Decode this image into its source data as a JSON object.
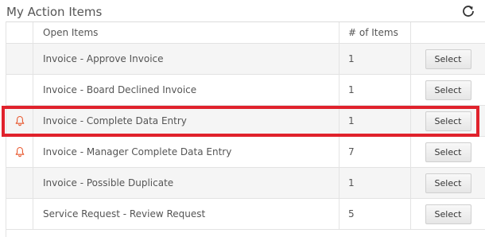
{
  "panel": {
    "title": "My Action Items",
    "refresh_icon": "refresh-icon"
  },
  "table": {
    "headers": {
      "icon": "",
      "open_items": "Open Items",
      "count": "# of Items",
      "action": ""
    },
    "rows": [
      {
        "label": "Invoice - Approve Invoice",
        "count": "1",
        "button": "Select",
        "alert": false
      },
      {
        "label": "Invoice - Board Declined Invoice",
        "count": "1",
        "button": "Select",
        "alert": false
      },
      {
        "label": "Invoice - Complete Data Entry",
        "count": "1",
        "button": "Select",
        "alert": true
      },
      {
        "label": "Invoice - Manager Complete Data Entry",
        "count": "7",
        "button": "Select",
        "alert": true
      },
      {
        "label": "Invoice - Possible Duplicate",
        "count": "1",
        "button": "Select",
        "alert": false
      },
      {
        "label": "Service Request - Review Request",
        "count": "5",
        "button": "Select",
        "alert": false
      }
    ]
  },
  "colors": {
    "alert_icon": "#e8552b",
    "highlight_border": "#e0222c"
  }
}
